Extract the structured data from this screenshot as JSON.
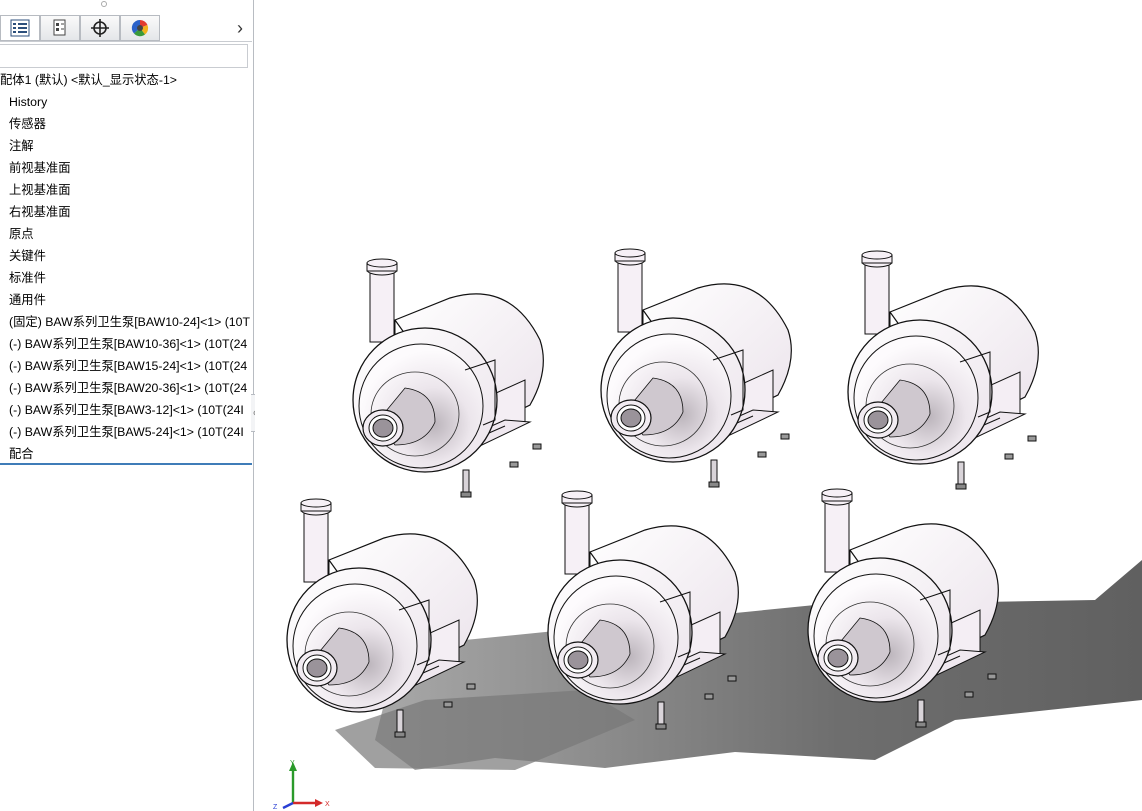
{
  "feature_manager": {
    "tabs": [
      {
        "name": "featuremanager-tree",
        "icon": "tree-list-icon"
      },
      {
        "name": "property-manager",
        "icon": "property-icon"
      },
      {
        "name": "configuration-manager",
        "icon": "crosshair-icon"
      },
      {
        "name": "appearance-manager",
        "icon": "color-wheel-icon"
      }
    ],
    "more_glyph": "›",
    "root": "配体1 (默认) <默认_显示状态-1>",
    "items": [
      {
        "label": "History",
        "icon": "history-folder-icon"
      },
      {
        "label": "传感器",
        "icon": "sensor-folder-icon"
      },
      {
        "label": "注解",
        "icon": "annotation-folder-icon"
      },
      {
        "label": "前视基准面",
        "icon": "plane-icon"
      },
      {
        "label": "上视基准面",
        "icon": "plane-icon"
      },
      {
        "label": "右视基准面",
        "icon": "plane-icon"
      },
      {
        "label": "原点",
        "icon": "origin-icon"
      },
      {
        "label": "关键件",
        "icon": "folder-icon"
      },
      {
        "label": "标准件",
        "icon": "folder-icon"
      },
      {
        "label": "通用件",
        "icon": "folder-icon"
      },
      {
        "label": "(固定) BAW系列卫生泵[BAW10-24]<1> (10T",
        "icon": "part-icon"
      },
      {
        "label": "(-) BAW系列卫生泵[BAW10-36]<1> (10T(24",
        "icon": "part-icon"
      },
      {
        "label": "(-) BAW系列卫生泵[BAW15-24]<1> (10T(24",
        "icon": "part-icon"
      },
      {
        "label": "(-) BAW系列卫生泵[BAW20-36]<1> (10T(24",
        "icon": "part-icon"
      },
      {
        "label": "(-) BAW系列卫生泵[BAW3-12]<1> (10T(24I",
        "icon": "part-icon"
      },
      {
        "label": "(-) BAW系列卫生泵[BAW5-24]<1> (10T(24I",
        "icon": "part-icon"
      },
      {
        "label": "配合",
        "icon": "mates-icon"
      }
    ]
  },
  "graphics": {
    "triad": {
      "x": "X",
      "y": "Y",
      "z": "Z"
    }
  },
  "colors": {
    "accent": "#3f7cb8",
    "part_icon": "#d8b020",
    "folder_icon": "#3a7fc4",
    "axis_x": "#d42a2a",
    "axis_y": "#2a9a2a",
    "axis_z": "#2a3fd4",
    "pump_body": "#f6f0f6",
    "shadow": "#5a5a5a"
  }
}
